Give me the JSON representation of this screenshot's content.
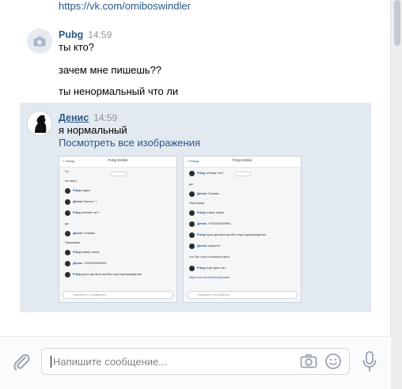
{
  "link_top": "https://vk.com/omiboswindler",
  "msg_pubg": {
    "author": "Pubg",
    "time": "14:59",
    "lines": [
      "ты кто?",
      "зачем мне пишешь??",
      "ты ненормальный что ли"
    ]
  },
  "msg_denis": {
    "author": "Денис",
    "time": "14:59",
    "text": "я нормальный",
    "link": "Посмотреть все изображения"
  },
  "thumb1": {
    "title": "Pubg Mobile",
    "back": "< Назад",
    "items": [
      {
        "n": "",
        "t": "Хз"
      },
      {
        "n": "",
        "t": "Не могу"
      },
      {
        "n": "Pubg",
        "t": "ладно"
      },
      {
        "n": "Денис",
        "t": "Бериш..?"
      },
      {
        "n": "Pubg",
        "t": "обнова нет?"
      },
      {
        "n": "",
        "t": "да"
      },
      {
        "n": "Денис",
        "t": "Отзывы"
      },
      {
        "n": "",
        "t": "Перепиши"
      },
      {
        "n": "Pubg",
        "t": "номер кина)"
      },
      {
        "n": "Денис",
        "t": "+375290289993"
      },
      {
        "n": "Pubg",
        "t": "щась должна пройти код подтверждение"
      }
    ],
    "input": "Напишите сообщение..."
  },
  "thumb2": {
    "title": "Pubg Mobile",
    "back": "< Назад",
    "items": [
      {
        "n": "Pubg",
        "t": "обнова нет?"
      },
      {
        "n": "",
        "t": "да"
      },
      {
        "n": "Денис",
        "t": "Отзывы"
      },
      {
        "n": "",
        "t": "Перепиши"
      },
      {
        "n": "Pubg",
        "t": "номер кина)"
      },
      {
        "n": "Денис",
        "t": "+375290289993"
      },
      {
        "n": "Pubg",
        "t": "щась должна пройти код подтверждение"
      },
      {
        "n": "Денис",
        "t": "пришло?"
      },
      {
        "n": "",
        "t": "что бы я мог оплатить кина"
      },
      {
        "n": "Pubg",
        "t": "ещё один чат"
      },
      {
        "n": "",
        "t": "https://vk.com/omiboswindler"
      }
    ],
    "input": "Напишите сообщение..."
  },
  "composer": {
    "placeholder": "Напишите сообщение..."
  },
  "icons": {
    "attach": "paperclip-icon",
    "camera": "camera-icon",
    "smile": "smile-icon",
    "mic": "microphone-icon"
  },
  "colors": {
    "link": "#2a5885",
    "selected_bg": "#e3e9f0",
    "time": "#939393"
  }
}
